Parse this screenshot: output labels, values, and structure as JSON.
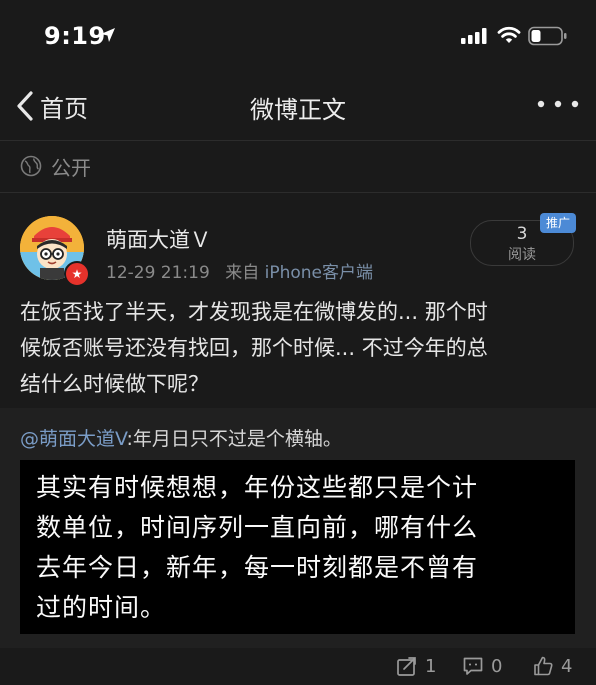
{
  "status_bar": {
    "time": "9:19"
  },
  "nav": {
    "back_label": "首页",
    "title": "微博正文"
  },
  "visibility": {
    "label": "公开"
  },
  "post": {
    "author": "萌面大道Ｖ",
    "timestamp": "12-29 21:19",
    "source_prefix": "来自",
    "source": "iPhone客户端",
    "read_count": "3",
    "read_label": "阅读",
    "promo_tag": "推广",
    "line1": "在饭否找了半天，才发现我是在微博发的... 那个时",
    "line2": "候饭否账号还没有找回，那个时候... 不过今年的总",
    "line3": "结什么时候做下呢？"
  },
  "repost": {
    "mention": "@萌面大道V",
    "text": ":年月日只不过是个横轴。",
    "image_line1": "其实有时候想想，年份这些都只是个计",
    "image_line2": "数单位，时间序列一直向前，哪有什么",
    "image_line3": "去年今日，新年，每一时刻都是不曾有",
    "image_line4": "过的时间。"
  },
  "actions": {
    "share_count": "1",
    "comment_count": "0",
    "like_count": "4"
  },
  "colors": {
    "background": "#1a1a1a",
    "link": "#7a9cc6",
    "promo": "#4c8ad6",
    "badge": "#e6322b"
  },
  "icons": [
    "location-icon",
    "signal-icon",
    "wifi-icon",
    "battery-icon",
    "back-chevron-icon",
    "more-icon",
    "globe-icon",
    "share-icon",
    "comment-icon",
    "like-icon"
  ]
}
